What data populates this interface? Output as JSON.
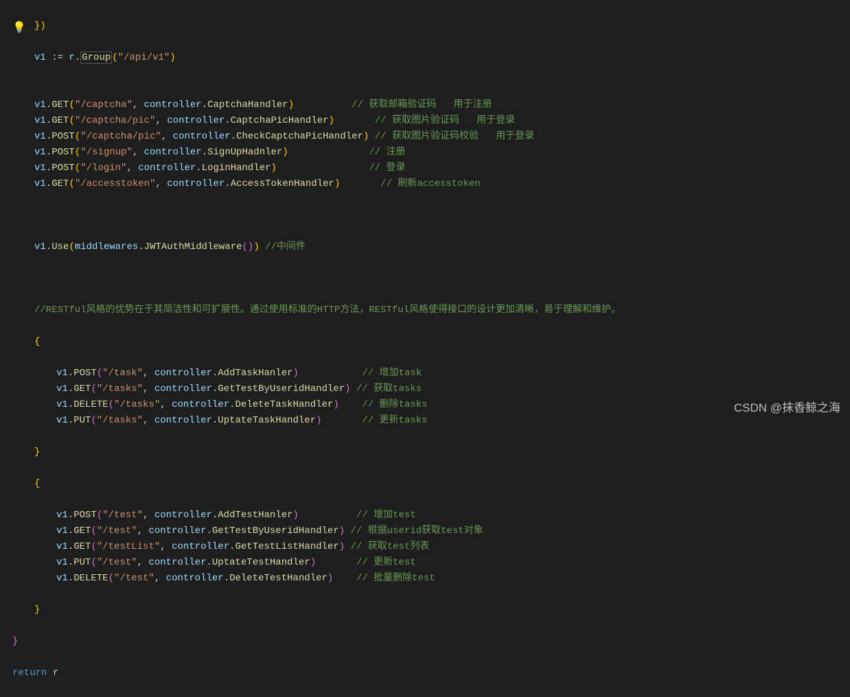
{
  "watermark": "CSDN @抹香鲸之海",
  "lang": "go",
  "code": {
    "l1": {
      "close": "})"
    },
    "l2": {
      "v": "v1",
      "op": " := ",
      "r": "r",
      "dot": ".",
      "group": "Group",
      "open": "(",
      "s": "\"/api/v1\"",
      "close": ")"
    },
    "routes1": [
      {
        "v": "v1",
        "m": "GET",
        "s": "\"/captcha\"",
        "c": "controller",
        "h": "CaptchaHandler",
        "pad": "         ",
        "cm": "// 获取邮箱验证码   用于注册"
      },
      {
        "v": "v1",
        "m": "GET",
        "s": "\"/captcha/pic\"",
        "c": "controller",
        "h": "CaptchaPicHandler",
        "pad": "      ",
        "cm": "// 获取图片验证码   用于登录"
      },
      {
        "v": "v1",
        "m": "POST",
        "s": "\"/captcha/pic\"",
        "c": "controller",
        "h": "CheckCaptchaPicHandler",
        "pad": "",
        "cm": "// 获取图片验证码校验   用于登录"
      },
      {
        "v": "v1",
        "m": "POST",
        "s": "\"/signup\"",
        "c": "controller",
        "h": "SignUpHadnler",
        "pad": "             ",
        "cm": "// 注册"
      },
      {
        "v": "v1",
        "m": "POST",
        "s": "\"/login\"",
        "c": "controller",
        "h": "LoginHandler",
        "pad": "               ",
        "cm": "// 登录"
      },
      {
        "v": "v1",
        "m": "GET",
        "s": "\"/accesstoken\"",
        "c": "controller",
        "h": "AccessTokenHandler",
        "pad": "      ",
        "cm": "// 刷新accesstoken"
      }
    ],
    "mw": {
      "v": "v1",
      "use": "Use",
      "m": "middlewares",
      "f": "JWTAuthMiddleware",
      "cm": "//中间件"
    },
    "restcmt": "//RESTful风格的优势在于其简洁性和可扩展性。通过使用标准的HTTP方法，RESTful风格使得接口的设计更加清晰，易于理解和维护。",
    "routes2": [
      {
        "v": "v1",
        "m": "POST",
        "s": "\"/task\"",
        "c": "controller",
        "h": "AddTaskHanler",
        "pad": "          ",
        "cm": "// 增加task"
      },
      {
        "v": "v1",
        "m": "GET",
        "s": "\"/tasks\"",
        "c": "controller",
        "h": "GetTestByUseridHandler",
        "pad": "",
        "cm": "// 获取tasks"
      },
      {
        "v": "v1",
        "m": "DELETE",
        "s": "\"/tasks\"",
        "c": "controller",
        "h": "DeleteTaskHandler",
        "pad": "   ",
        "cm": "// 删除tasks"
      },
      {
        "v": "v1",
        "m": "PUT",
        "s": "\"/tasks\"",
        "c": "controller",
        "h": "UptateTaskHandler",
        "pad": "      ",
        "cm": "// 更新tasks"
      }
    ],
    "routes3": [
      {
        "v": "v1",
        "m": "POST",
        "s": "\"/test\"",
        "c": "controller",
        "h": "AddTestHanler",
        "pad": "         ",
        "cm": "// 增加test"
      },
      {
        "v": "v1",
        "m": "GET",
        "s": "\"/test\"",
        "c": "controller",
        "h": "GetTestByUseridHandler",
        "pad": "",
        "cm": "// 根据userid获取test对象"
      },
      {
        "v": "v1",
        "m": "GET",
        "s": "\"/testList\"",
        "c": "controller",
        "h": "GetTestListHandler",
        "pad": "",
        "cm": "// 获取test列表"
      },
      {
        "v": "v1",
        "m": "PUT",
        "s": "\"/test\"",
        "c": "controller",
        "h": "UptateTestHandler",
        "pad": "      ",
        "cm": "// 更新test"
      },
      {
        "v": "v1",
        "m": "DELETE",
        "s": "\"/test\"",
        "c": "controller",
        "h": "DeleteTestHandler",
        "pad": "   ",
        "cm": "// 批量删除test"
      }
    ],
    "ret": {
      "kw": "return",
      "v": "r"
    }
  }
}
